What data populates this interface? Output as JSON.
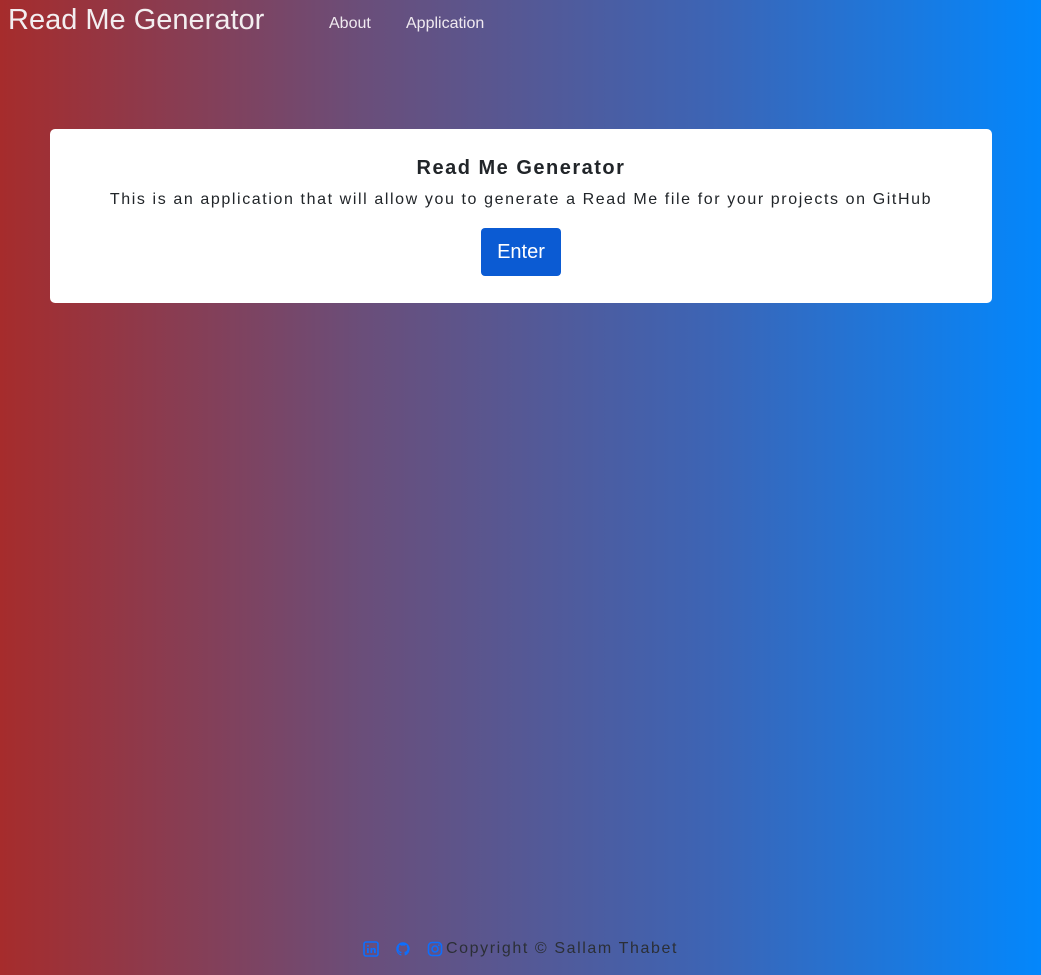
{
  "navbar": {
    "brand": "Read Me Generator",
    "links": [
      {
        "label": "About"
      },
      {
        "label": "Application"
      }
    ]
  },
  "card": {
    "title": "Read Me Generator",
    "text": "This is an application that will allow you to generate a Read Me file for your projects on GitHub",
    "button_label": "Enter"
  },
  "footer": {
    "icons": [
      "linkedin-icon",
      "github-icon",
      "instagram-icon"
    ],
    "copyright": "Copyright © Sallam Thabet"
  },
  "colors": {
    "gradient_left": "#a62c2c",
    "gradient_right": "#0387fc",
    "button": "#0b5bd3",
    "icon": "#0d6efd"
  }
}
